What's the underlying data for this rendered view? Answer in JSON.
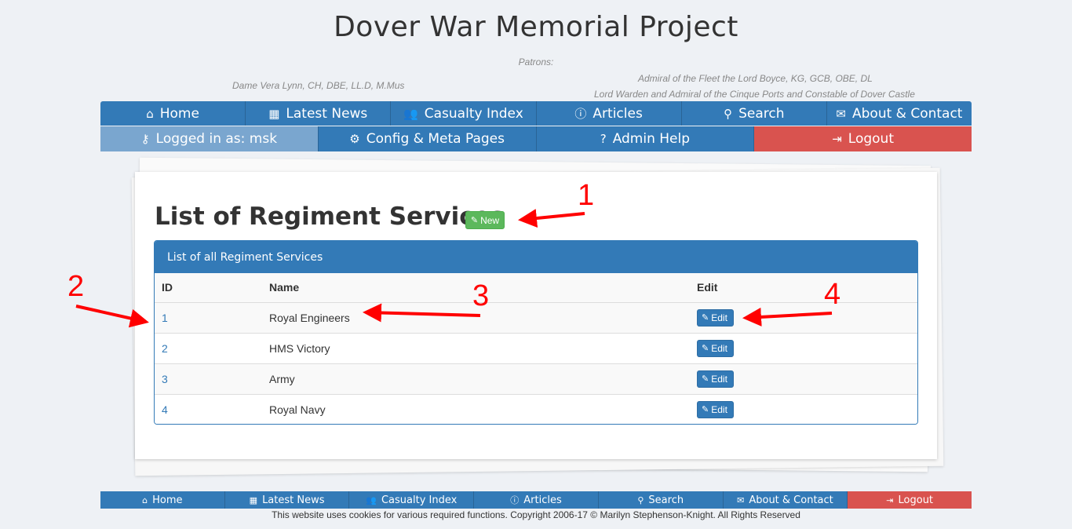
{
  "header": {
    "title": "Dover War Memorial Project",
    "patrons_label": "Patrons:",
    "patron_left": "Dame Vera Lynn, CH, DBE, LL.D, M.Mus",
    "patron_right_1": "Admiral of the Fleet the Lord Boyce, KG, GCB, OBE, DL",
    "patron_right_2": "Lord Warden and Admiral of the Cinque Ports and Constable of Dover Castle"
  },
  "nav_main": [
    {
      "label": "Home",
      "icon": "home-icon",
      "glyph": "⌂"
    },
    {
      "label": "Latest News",
      "icon": "calendar-icon",
      "glyph": "▦"
    },
    {
      "label": "Casualty Index",
      "icon": "users-icon",
      "glyph": "👥"
    },
    {
      "label": "Articles",
      "icon": "info-icon",
      "glyph": "ⓘ"
    },
    {
      "label": "Search",
      "icon": "search-icon",
      "glyph": "⚲"
    },
    {
      "label": "About & Contact",
      "icon": "envelope-icon",
      "glyph": "✉"
    }
  ],
  "nav_admin": [
    {
      "label": "Logged in as: msk",
      "icon": "key-icon",
      "glyph": "⚷"
    },
    {
      "label": "Config & Meta Pages",
      "icon": "cogs-icon",
      "glyph": "⚙"
    },
    {
      "label": "Admin Help",
      "icon": "question-icon",
      "glyph": "?"
    },
    {
      "label": "Logout",
      "icon": "sign-out-icon",
      "glyph": "⇥"
    }
  ],
  "content": {
    "heading": "List of Regiment Services",
    "new_label": "New",
    "panel_title": "List of all Regiment Services",
    "columns": [
      "ID",
      "Name",
      "Edit"
    ],
    "rows": [
      {
        "id": "1",
        "name": "Royal Engineers",
        "edit": "Edit"
      },
      {
        "id": "2",
        "name": "HMS Victory",
        "edit": "Edit"
      },
      {
        "id": "3",
        "name": "Army",
        "edit": "Edit"
      },
      {
        "id": "4",
        "name": "Royal Navy",
        "edit": "Edit"
      }
    ]
  },
  "footer": {
    "nav": [
      {
        "label": "Home",
        "icon": "home-icon",
        "glyph": "⌂"
      },
      {
        "label": "Latest News",
        "icon": "calendar-icon",
        "glyph": "▦"
      },
      {
        "label": "Casualty Index",
        "icon": "users-icon",
        "glyph": "👥"
      },
      {
        "label": "Articles",
        "icon": "info-icon",
        "glyph": "ⓘ"
      },
      {
        "label": "Search",
        "icon": "search-icon",
        "glyph": "⚲"
      },
      {
        "label": "About & Contact",
        "icon": "envelope-icon",
        "glyph": "✉"
      },
      {
        "label": "Logout",
        "icon": "sign-out-icon",
        "glyph": "⇥"
      }
    ],
    "copyright": "This website uses cookies for various required functions. Copyright 2006-17 © Marilyn Stephenson-Knight. All Rights Reserved"
  },
  "annotations": [
    "1",
    "2",
    "3",
    "4"
  ],
  "colors": {
    "primary": "#337ab7",
    "danger": "#d9534f",
    "success": "#5cb85c",
    "annotation": "#ff0000",
    "background": "#eef1f5"
  }
}
